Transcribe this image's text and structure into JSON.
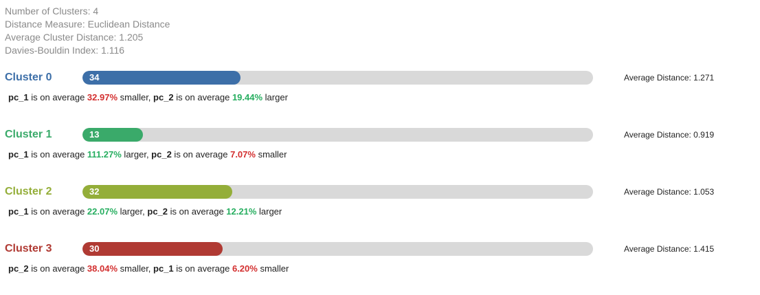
{
  "summary": {
    "num_clusters": "Number of Clusters: 4",
    "distance_measure": "Distance Measure: Euclidean Distance",
    "avg_cluster_distance": "Average Cluster Distance: 1.205",
    "davies_bouldin": "Davies-Bouldin Index: 1.116"
  },
  "colors": {
    "larger": "#27ae60",
    "smaller": "#d32f2f",
    "track": "#d9d9d9"
  },
  "clusters": [
    {
      "name": "Cluster 0",
      "color": "#3d6fa8",
      "size": "34",
      "bar_fraction": 0.31,
      "avg_distance": "Average Distance: 1.271",
      "parts": [
        {
          "t": "b",
          "v": "pc_1"
        },
        {
          "t": "text",
          "v": " is on average "
        },
        {
          "t": "down",
          "v": "32.97%"
        },
        {
          "t": "text",
          "v": " smaller, "
        },
        {
          "t": "b",
          "v": "pc_2"
        },
        {
          "t": "text",
          "v": " is on average "
        },
        {
          "t": "up",
          "v": "19.44%"
        },
        {
          "t": "text",
          "v": " larger"
        }
      ]
    },
    {
      "name": "Cluster 1",
      "color": "#3aaa6a",
      "size": "13",
      "bar_fraction": 0.119,
      "avg_distance": "Average Distance: 0.919",
      "parts": [
        {
          "t": "b",
          "v": "pc_1"
        },
        {
          "t": "text",
          "v": " is on average "
        },
        {
          "t": "up",
          "v": "111.27%"
        },
        {
          "t": "text",
          "v": " larger, "
        },
        {
          "t": "b",
          "v": "pc_2"
        },
        {
          "t": "text",
          "v": " is on average "
        },
        {
          "t": "down",
          "v": "7.07%"
        },
        {
          "t": "text",
          "v": " smaller"
        }
      ]
    },
    {
      "name": "Cluster 2",
      "color": "#94ae39",
      "size": "32",
      "bar_fraction": 0.293,
      "avg_distance": "Average Distance: 1.053",
      "parts": [
        {
          "t": "b",
          "v": "pc_1"
        },
        {
          "t": "text",
          "v": " is on average "
        },
        {
          "t": "up",
          "v": "22.07%"
        },
        {
          "t": "text",
          "v": " larger, "
        },
        {
          "t": "b",
          "v": "pc_2"
        },
        {
          "t": "text",
          "v": " is on average "
        },
        {
          "t": "up",
          "v": "12.21%"
        },
        {
          "t": "text",
          "v": " larger"
        }
      ]
    },
    {
      "name": "Cluster 3",
      "color": "#b03a33",
      "size": "30",
      "bar_fraction": 0.275,
      "avg_distance": "Average Distance: 1.415",
      "parts": [
        {
          "t": "b",
          "v": "pc_2"
        },
        {
          "t": "text",
          "v": " is on average "
        },
        {
          "t": "down",
          "v": "38.04%"
        },
        {
          "t": "text",
          "v": " smaller, "
        },
        {
          "t": "b",
          "v": "pc_1"
        },
        {
          "t": "text",
          "v": " is on average "
        },
        {
          "t": "down",
          "v": "6.20%"
        },
        {
          "t": "text",
          "v": " smaller"
        }
      ]
    }
  ]
}
